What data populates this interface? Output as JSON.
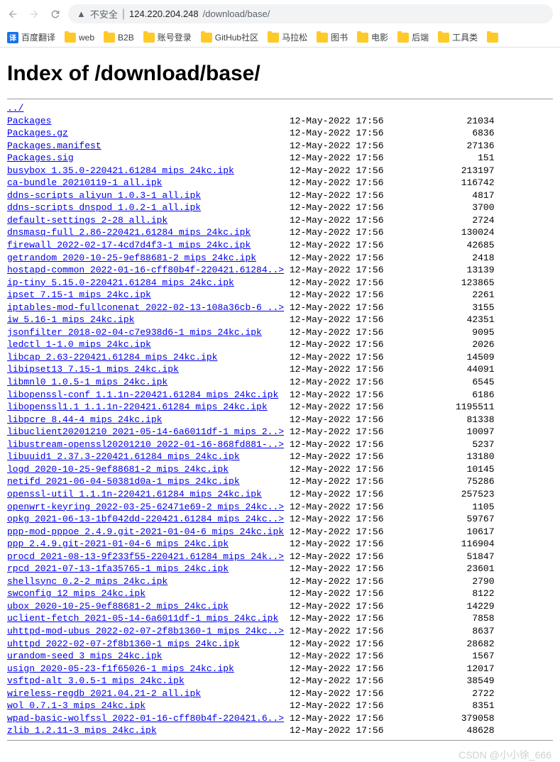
{
  "browser": {
    "insecure_label": "不安全",
    "url_host": "124.220.204.248",
    "url_path": "/download/base/"
  },
  "bookmarks": [
    {
      "label": "百度翻译",
      "icon": "blue"
    },
    {
      "label": "web",
      "icon": "folder"
    },
    {
      "label": "B2B",
      "icon": "folder"
    },
    {
      "label": "账号登录",
      "icon": "folder"
    },
    {
      "label": "GitHub社区",
      "icon": "folder"
    },
    {
      "label": "马拉松",
      "icon": "folder"
    },
    {
      "label": "图书",
      "icon": "folder"
    },
    {
      "label": "电影",
      "icon": "folder"
    },
    {
      "label": "后端",
      "icon": "folder"
    },
    {
      "label": "工具类",
      "icon": "folder"
    },
    {
      "label": "",
      "icon": "folder"
    }
  ],
  "page": {
    "title": "Index of /download/base/",
    "parent_link": "../",
    "files": [
      {
        "name": "Packages",
        "date": "12-May-2022 17:56",
        "size": "21034"
      },
      {
        "name": "Packages.gz",
        "date": "12-May-2022 17:56",
        "size": "6836"
      },
      {
        "name": "Packages.manifest",
        "date": "12-May-2022 17:56",
        "size": "27136"
      },
      {
        "name": "Packages.sig",
        "date": "12-May-2022 17:56",
        "size": "151"
      },
      {
        "name": "busybox_1.35.0-220421.61284_mips_24kc.ipk",
        "date": "12-May-2022 17:56",
        "size": "213197"
      },
      {
        "name": "ca-bundle_20210119-1_all.ipk",
        "date": "12-May-2022 17:56",
        "size": "116742"
      },
      {
        "name": "ddns-scripts_aliyun_1.0.3-1_all.ipk",
        "date": "12-May-2022 17:56",
        "size": "4817"
      },
      {
        "name": "ddns-scripts_dnspod_1.0.2-1_all.ipk",
        "date": "12-May-2022 17:56",
        "size": "3700"
      },
      {
        "name": "default-settings_2-28_all.ipk",
        "date": "12-May-2022 17:56",
        "size": "2724"
      },
      {
        "name": "dnsmasq-full_2.86-220421.61284_mips_24kc.ipk",
        "date": "12-May-2022 17:56",
        "size": "130024"
      },
      {
        "name": "firewall_2022-02-17-4cd7d4f3-1_mips_24kc.ipk",
        "date": "12-May-2022 17:56",
        "size": "42685"
      },
      {
        "name": "getrandom_2020-10-25-9ef88681-2_mips_24kc.ipk",
        "date": "12-May-2022 17:56",
        "size": "2418"
      },
      {
        "name": "hostapd-common_2022-01-16-cff80b4f-220421.61284..>",
        "date": "12-May-2022 17:56",
        "size": "13139"
      },
      {
        "name": "ip-tiny_5.15.0-220421.61284_mips_24kc.ipk",
        "date": "12-May-2022 17:56",
        "size": "123865"
      },
      {
        "name": "ipset_7.15-1_mips_24kc.ipk",
        "date": "12-May-2022 17:56",
        "size": "2261"
      },
      {
        "name": "iptables-mod-fullconenat_2022-02-13-108a36cb-6_..>",
        "date": "12-May-2022 17:56",
        "size": "3155"
      },
      {
        "name": "iw_5.16-1_mips_24kc.ipk",
        "date": "12-May-2022 17:56",
        "size": "42351"
      },
      {
        "name": "jsonfilter_2018-02-04-c7e938d6-1_mips_24kc.ipk",
        "date": "12-May-2022 17:56",
        "size": "9095"
      },
      {
        "name": "ledctl_1-1.0_mips_24kc.ipk",
        "date": "12-May-2022 17:56",
        "size": "2026"
      },
      {
        "name": "libcap_2.63-220421.61284_mips_24kc.ipk",
        "date": "12-May-2022 17:56",
        "size": "14509"
      },
      {
        "name": "libipset13_7.15-1_mips_24kc.ipk",
        "date": "12-May-2022 17:56",
        "size": "44091"
      },
      {
        "name": "libmnl0_1.0.5-1_mips_24kc.ipk",
        "date": "12-May-2022 17:56",
        "size": "6545"
      },
      {
        "name": "libopenssl-conf_1.1.1n-220421.61284_mips_24kc.ipk",
        "date": "12-May-2022 17:56",
        "size": "6186"
      },
      {
        "name": "libopenssl1.1_1.1.1n-220421.61284_mips_24kc.ipk",
        "date": "12-May-2022 17:56",
        "size": "1195511"
      },
      {
        "name": "libpcre_8.44-4_mips_24kc.ipk",
        "date": "12-May-2022 17:56",
        "size": "81338"
      },
      {
        "name": "libuclient20201210_2021-05-14-6a6011df-1_mips_2..>",
        "date": "12-May-2022 17:56",
        "size": "10097"
      },
      {
        "name": "libustream-openssl20201210_2022-01-16-868fd881-..>",
        "date": "12-May-2022 17:56",
        "size": "5237"
      },
      {
        "name": "libuuid1_2.37.3-220421.61284_mips_24kc.ipk",
        "date": "12-May-2022 17:56",
        "size": "13180"
      },
      {
        "name": "logd_2020-10-25-9ef88681-2_mips_24kc.ipk",
        "date": "12-May-2022 17:56",
        "size": "10145"
      },
      {
        "name": "netifd_2021-06-04-50381d0a-1_mips_24kc.ipk",
        "date": "12-May-2022 17:56",
        "size": "75286"
      },
      {
        "name": "openssl-util_1.1.1n-220421.61284_mips_24kc.ipk",
        "date": "12-May-2022 17:56",
        "size": "257523"
      },
      {
        "name": "openwrt-keyring_2022-03-25-62471e69-2_mips_24kc..>",
        "date": "12-May-2022 17:56",
        "size": "1105"
      },
      {
        "name": "opkg_2021-06-13-1bf042dd-220421.61284_mips_24kc..>",
        "date": "12-May-2022 17:56",
        "size": "59767"
      },
      {
        "name": "ppp-mod-pppoe_2.4.9.git-2021-01-04-6_mips_24kc.ipk",
        "date": "12-May-2022 17:56",
        "size": "10617"
      },
      {
        "name": "ppp_2.4.9.git-2021-01-04-6_mips_24kc.ipk",
        "date": "12-May-2022 17:56",
        "size": "116904"
      },
      {
        "name": "procd_2021-08-13-9f233f55-220421.61284_mips_24k..>",
        "date": "12-May-2022 17:56",
        "size": "51847"
      },
      {
        "name": "rpcd_2021-07-13-1fa35765-1_mips_24kc.ipk",
        "date": "12-May-2022 17:56",
        "size": "23601"
      },
      {
        "name": "shellsync_0.2-2_mips_24kc.ipk",
        "date": "12-May-2022 17:56",
        "size": "2790"
      },
      {
        "name": "swconfig_12_mips_24kc.ipk",
        "date": "12-May-2022 17:56",
        "size": "8122"
      },
      {
        "name": "ubox_2020-10-25-9ef88681-2_mips_24kc.ipk",
        "date": "12-May-2022 17:56",
        "size": "14229"
      },
      {
        "name": "uclient-fetch_2021-05-14-6a6011df-1_mips_24kc.ipk",
        "date": "12-May-2022 17:56",
        "size": "7858"
      },
      {
        "name": "uhttpd-mod-ubus_2022-02-07-2f8b1360-1_mips_24kc..>",
        "date": "12-May-2022 17:56",
        "size": "8637"
      },
      {
        "name": "uhttpd_2022-02-07-2f8b1360-1_mips_24kc.ipk",
        "date": "12-May-2022 17:56",
        "size": "28682"
      },
      {
        "name": "urandom-seed_3_mips_24kc.ipk",
        "date": "12-May-2022 17:56",
        "size": "1567"
      },
      {
        "name": "usign_2020-05-23-f1f65026-1_mips_24kc.ipk",
        "date": "12-May-2022 17:56",
        "size": "12017"
      },
      {
        "name": "vsftpd-alt_3.0.5-1_mips_24kc.ipk",
        "date": "12-May-2022 17:56",
        "size": "38549"
      },
      {
        "name": "wireless-regdb_2021.04.21-2_all.ipk",
        "date": "12-May-2022 17:56",
        "size": "2722"
      },
      {
        "name": "wol_0.7.1-3_mips_24kc.ipk",
        "date": "12-May-2022 17:56",
        "size": "8351"
      },
      {
        "name": "wpad-basic-wolfssl_2022-01-16-cff80b4f-220421.6..>",
        "date": "12-May-2022 17:56",
        "size": "379058"
      },
      {
        "name": "zlib_1.2.11-3_mips_24kc.ipk",
        "date": "12-May-2022 17:56",
        "size": "48628"
      }
    ]
  },
  "watermark": "CSDN @小小徐_666"
}
